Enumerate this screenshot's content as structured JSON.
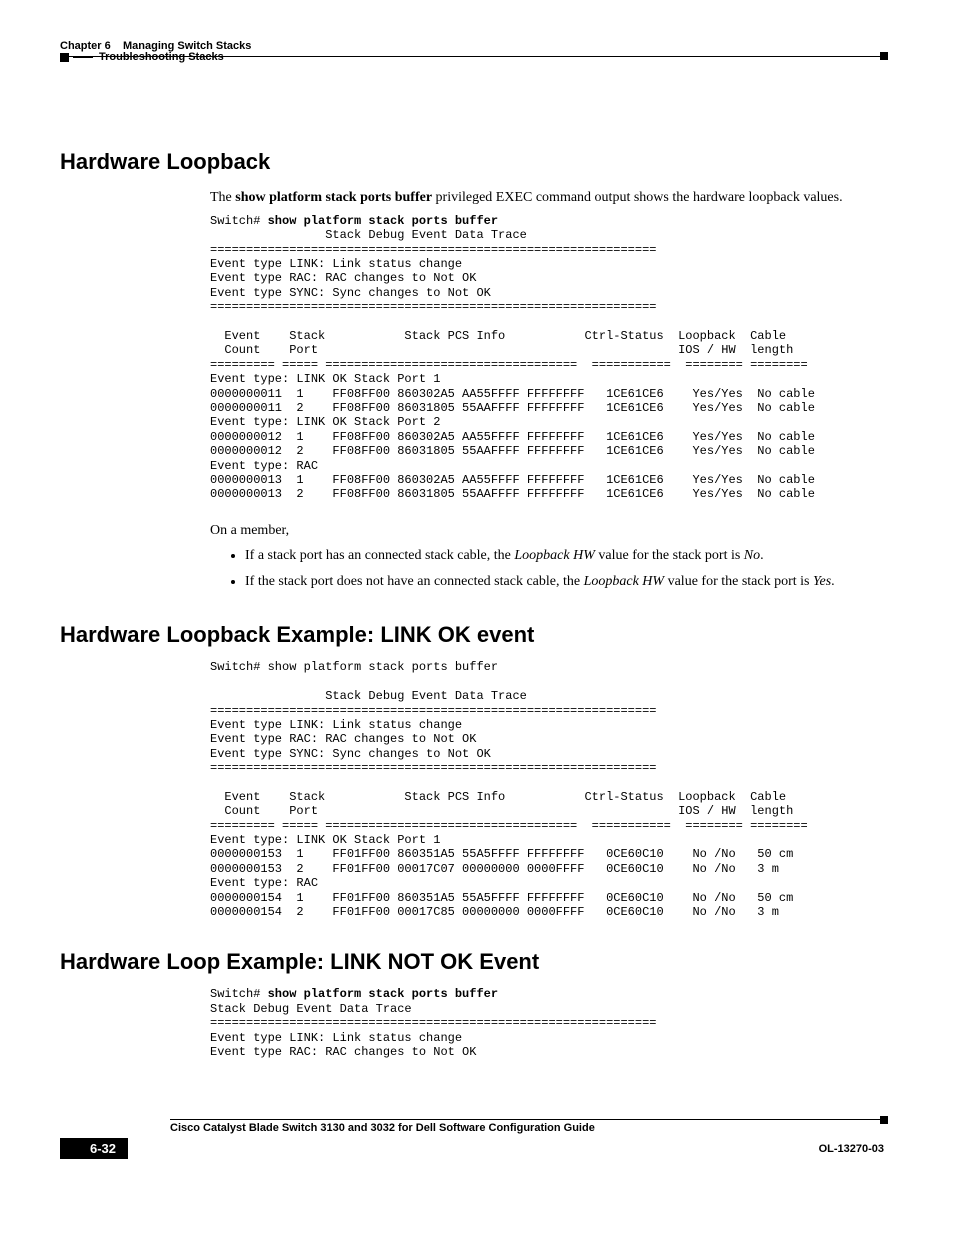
{
  "header": {
    "left": "Troubleshooting Stacks",
    "chapter": "Chapter 6",
    "title": "Managing Switch Stacks"
  },
  "section1": {
    "heading": "Hardware Loopback",
    "intro_pre": "The ",
    "intro_cmd": "show platform stack ports buffer",
    "intro_post": " privileged EXEC command output shows the hardware loopback values.",
    "code_prefix": "Switch# ",
    "code_cmd": "show platform stack ports buffer",
    "code_body": "                Stack Debug Event Data Trace\n==============================================================\nEvent type LINK: Link status change\nEvent type RAC: RAC changes to Not OK\nEvent type SYNC: Sync changes to Not OK\n==============================================================\n\n  Event    Stack           Stack PCS Info           Ctrl-Status  Loopback  Cable\n  Count    Port                                                  IOS / HW  length\n========= ===== ===================================  ===========  ======== ========\nEvent type: LINK OK Stack Port 1\n0000000011  1    FF08FF00 860302A5 AA55FFFF FFFFFFFF   1CE61CE6    Yes/Yes  No cable\n0000000011  2    FF08FF00 86031805 55AAFFFF FFFFFFFF   1CE61CE6    Yes/Yes  No cable\nEvent type: LINK OK Stack Port 2\n0000000012  1    FF08FF00 860302A5 AA55FFFF FFFFFFFF   1CE61CE6    Yes/Yes  No cable\n0000000012  2    FF08FF00 86031805 55AAFFFF FFFFFFFF   1CE61CE6    Yes/Yes  No cable\nEvent type: RAC\n0000000013  1    FF08FF00 860302A5 AA55FFFF FFFFFFFF   1CE61CE6    Yes/Yes  No cable\n0000000013  2    FF08FF00 86031805 55AAFFFF FFFFFFFF   1CE61CE6    Yes/Yes  No cable",
    "member_intro": "On a member,",
    "bullet1_pre": "If a stack port has an connected stack cable, the ",
    "bullet1_em1": "Loopback HW",
    "bullet1_mid": " value for the stack port is ",
    "bullet1_em2": "No",
    "bullet1_end": ".",
    "bullet2_pre": "If the stack port does not have an connected stack cable, the ",
    "bullet2_em1": "Loopback HW",
    "bullet2_mid": " value for the stack port is ",
    "bullet2_em2": "Yes",
    "bullet2_end": "."
  },
  "section2": {
    "heading": "Hardware Loopback Example: LINK OK event",
    "code": "Switch# show platform stack ports buffer\n\n                Stack Debug Event Data Trace\n==============================================================\nEvent type LINK: Link status change\nEvent type RAC: RAC changes to Not OK\nEvent type SYNC: Sync changes to Not OK\n==============================================================\n\n  Event    Stack           Stack PCS Info           Ctrl-Status  Loopback  Cable\n  Count    Port                                                  IOS / HW  length\n========= ===== ===================================  ===========  ======== ========\nEvent type: LINK OK Stack Port 1\n0000000153  1    FF01FF00 860351A5 55A5FFFF FFFFFFFF   0CE60C10    No /No   50 cm\n0000000153  2    FF01FF00 00017C07 00000000 0000FFFF   0CE60C10    No /No   3 m\nEvent type: RAC\n0000000154  1    FF01FF00 860351A5 55A5FFFF FFFFFFFF   0CE60C10    No /No   50 cm\n0000000154  2    FF01FF00 00017C85 00000000 0000FFFF   0CE60C10    No /No   3 m"
  },
  "section3": {
    "heading": "Hardware Loop Example: LINK NOT OK Event",
    "code_prefix": "Switch# ",
    "code_cmd": "show platform stack ports buffer",
    "code_body": "Stack Debug Event Data Trace\n==============================================================\nEvent type LINK: Link status change\nEvent type RAC: RAC changes to Not OK"
  },
  "footer": {
    "title": "Cisco Catalyst Blade Switch 3130 and 3032 for Dell Software Configuration Guide",
    "page": "6-32",
    "docid": "OL-13270-03"
  }
}
